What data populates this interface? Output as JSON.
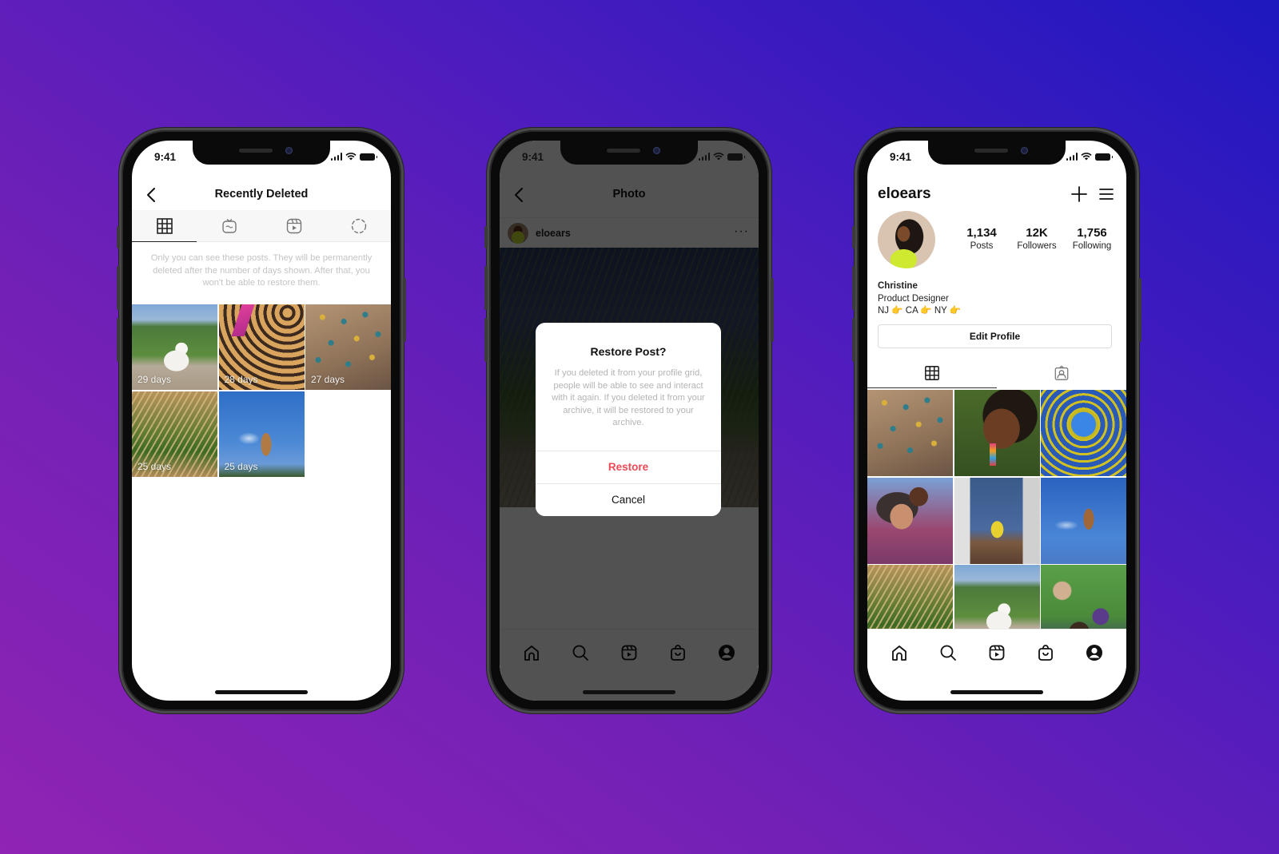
{
  "status_bar": {
    "time": "9:41"
  },
  "phones": {
    "recently_deleted": {
      "title": "Recently Deleted",
      "tabs": [
        {
          "icon": "grid-icon",
          "active": true
        },
        {
          "icon": "igtv-icon",
          "active": false
        },
        {
          "icon": "reels-icon",
          "active": false
        },
        {
          "icon": "stories-icon",
          "active": false
        }
      ],
      "note": "Only you can see these posts. They will be permanently deleted after the number of days shown. After that, you won't be able to restore them.",
      "items": [
        {
          "label": "29 days",
          "photo": "dog"
        },
        {
          "label": "28 days",
          "photo": "shadow"
        },
        {
          "label": "27 days",
          "photo": "climbing-wall"
        },
        {
          "label": "25 days",
          "photo": "grass"
        },
        {
          "label": "25 days",
          "photo": "ice-cream-cone"
        }
      ]
    },
    "photo": {
      "title": "Photo",
      "username": "eloears",
      "more_label": "···",
      "dialog": {
        "title": "Restore Post?",
        "body": "If you deleted it from your profile grid, people will be able to see and interact with it again. If you deleted it from your archive, it will be restored to your archive.",
        "restore_label": "Restore",
        "cancel_label": "Cancel",
        "restore_color": "#ed4956"
      }
    },
    "profile": {
      "username": "eloears",
      "stats": [
        {
          "value": "1,134",
          "label": "Posts"
        },
        {
          "value": "12K",
          "label": "Followers"
        },
        {
          "value": "1,756",
          "label": "Following"
        }
      ],
      "bio": {
        "name": "Christine",
        "title": "Product Designer",
        "locations": "NJ 👉 CA 👉 NY 👉"
      },
      "edit_profile_label": "Edit Profile",
      "tabs": [
        {
          "icon": "grid-icon",
          "active": true
        },
        {
          "icon": "tagged-icon",
          "active": false
        }
      ],
      "grid": [
        "climbing-wall",
        "woman-earring",
        "yellow-ring",
        "hug",
        "building-balloons",
        "ice-cream-cone",
        "grass",
        "dog",
        "group-circle"
      ]
    }
  },
  "bottom_nav": [
    "home",
    "search",
    "reels",
    "shop",
    "profile"
  ]
}
